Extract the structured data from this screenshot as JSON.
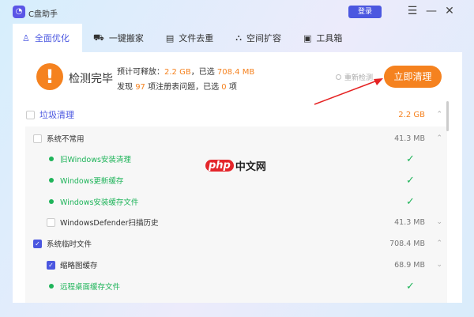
{
  "app": {
    "title": "C盘助手",
    "login": "登录"
  },
  "tabs": [
    {
      "label": "全面优化",
      "icon": "rocket-icon"
    },
    {
      "label": "一键搬家",
      "icon": "truck-icon"
    },
    {
      "label": "文件去重",
      "icon": "file-copy-icon"
    },
    {
      "label": "空间扩容",
      "icon": "expand-icon"
    },
    {
      "label": "工具箱",
      "icon": "toolbox-icon"
    }
  ],
  "summary": {
    "status": "检测完毕",
    "release_label": "预计可释放：",
    "release_value": "2.2 GB",
    "selected_label": "，已选",
    "selected_value": "708.4 MB",
    "found_label": "发现",
    "found_value": "97",
    "registry_label": "项注册表问题，已选",
    "registry_selected": "0",
    "unit": "项",
    "rescan": "重新检测",
    "clean": "立即清理"
  },
  "list": {
    "category": {
      "label": "垃圾清理",
      "size": "2.2 GB"
    },
    "items": [
      {
        "label": "系统不常用",
        "size": "41.3 MB"
      },
      {
        "label": "旧Windows安装清理"
      },
      {
        "label": "Windows更新缓存"
      },
      {
        "label": "Windows安装缓存文件"
      },
      {
        "label": "WindowsDefender扫描历史",
        "size": "41.3 MB"
      },
      {
        "label": "系统临时文件",
        "size": "708.4 MB"
      },
      {
        "label": "缩略图缓存",
        "size": "68.9 MB"
      },
      {
        "label": "远程桌面缓存文件"
      }
    ]
  },
  "watermark": {
    "p": "php",
    "text": "中文网"
  },
  "colors": {
    "accent": "#4b57e0",
    "orange": "#f5821f",
    "green": "#1fb45a"
  }
}
